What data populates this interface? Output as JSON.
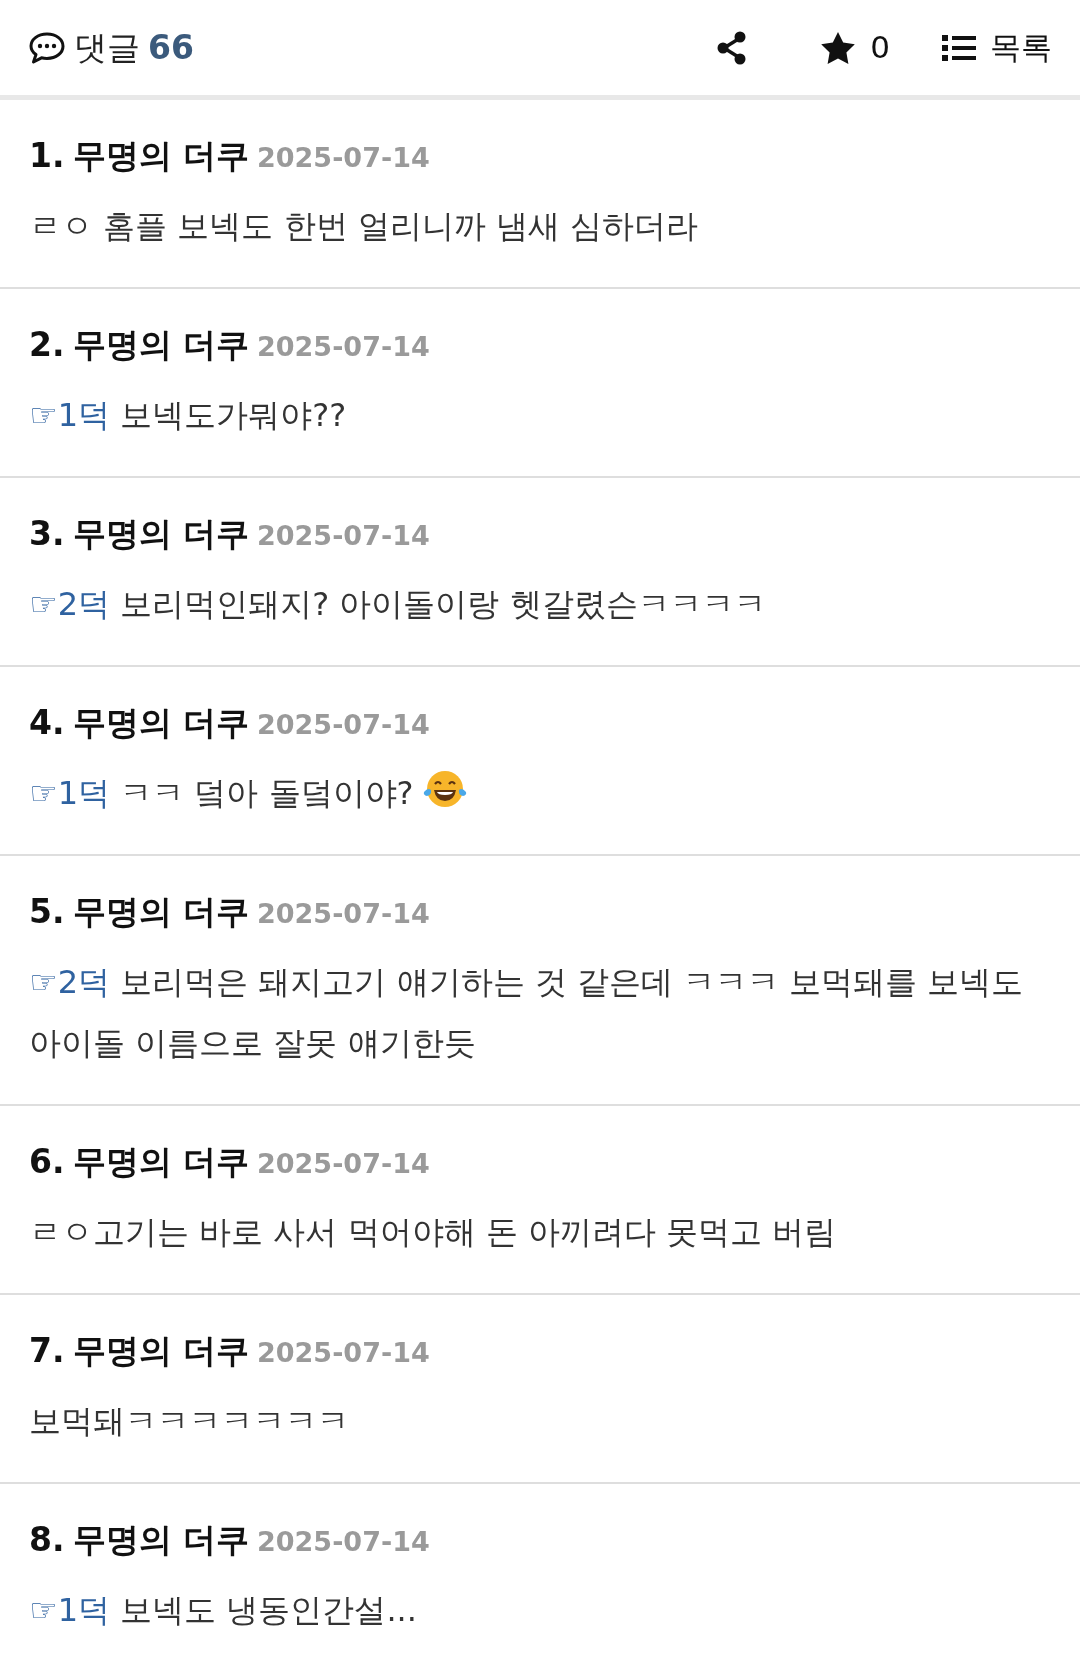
{
  "header": {
    "title": "댓글",
    "count": "66",
    "star_count": "0",
    "list_label": "목록"
  },
  "comments": [
    {
      "number": "1.",
      "author": "무명의 더쿠",
      "date": "2025-07-14",
      "text": "ㄹㅇ 홈플 보넥도 한번 얼리니까 냄새 심하더라",
      "emoji": false
    },
    {
      "number": "2.",
      "author": "무명의 더쿠",
      "date": "2025-07-14",
      "reply_to": "☞1덕",
      "text": "보넥도가뭐야??",
      "emoji": false
    },
    {
      "number": "3.",
      "author": "무명의 더쿠",
      "date": "2025-07-14",
      "reply_to": "☞2덕",
      "text": "보리먹인돼지? 아이돌이랑 헷갈렸슨ㅋㅋㅋㅋ",
      "emoji": false
    },
    {
      "number": "4.",
      "author": "무명의 더쿠",
      "date": "2025-07-14",
      "reply_to": "☞1덕",
      "text": "ㅋㅋ 덬아 돌덬이야?",
      "emoji": true
    },
    {
      "number": "5.",
      "author": "무명의 더쿠",
      "date": "2025-07-14",
      "reply_to": "☞2덕",
      "text": "보리먹은 돼지고기 얘기하는 것 같은데 ㅋㅋㅋ 보먹돼를 보넥도 아이돌 이름으로 잘못 얘기한듯",
      "emoji": false
    },
    {
      "number": "6.",
      "author": "무명의 더쿠",
      "date": "2025-07-14",
      "text": "ㄹㅇ고기는 바로 사서 먹어야해 돈 아끼려다 못먹고 버림",
      "emoji": false
    },
    {
      "number": "7.",
      "author": "무명의 더쿠",
      "date": "2025-07-14",
      "text": "보먹돼ㅋㅋㅋㅋㅋㅋㅋ",
      "emoji": false
    },
    {
      "number": "8.",
      "author": "무명의 더쿠",
      "date": "2025-07-14",
      "reply_to": "☞1덕",
      "text": "보넥도 냉동인간설...",
      "emoji": false
    }
  ]
}
